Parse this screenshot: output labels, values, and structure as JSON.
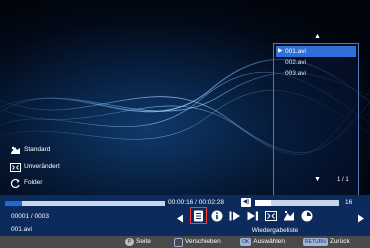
{
  "playlist": {
    "items": [
      {
        "label": "001.avi",
        "selected": true
      },
      {
        "label": "002.avi",
        "selected": false
      },
      {
        "label": "003.avi",
        "selected": false
      }
    ],
    "page": "1 / 1",
    "title": "Wiedergabeliste"
  },
  "options": [
    {
      "icon": "picture-mode-icon",
      "label": "Standard"
    },
    {
      "icon": "aspect-ratio-icon",
      "label": "Unverändert"
    },
    {
      "icon": "repeat-icon",
      "label": "Folder"
    }
  ],
  "playback": {
    "time": "00:00:16 / 00:02:28",
    "progress": 0.108,
    "volume": 16,
    "volume_level": 0.19,
    "counter": "00001 / 0003",
    "filename": "001.avi"
  },
  "controls": [
    "prev-arrow-icon",
    "playlist-icon",
    "info-icon",
    "step-forward-icon",
    "skip-next-icon",
    "fullscreen-icon",
    "aspect-icon",
    "settings-icon",
    "next-arrow-icon"
  ],
  "help": {
    "page_key": "P",
    "page_label": "Seite",
    "move_label": "Verschieben",
    "ok_key": "OK",
    "select_label": "Auswählen",
    "return_key": "RETURN",
    "back_label": "Zurück"
  },
  "colors": {
    "bar": "#0c2a5c",
    "progress_fill": "#1c6ad8",
    "selected_item": "#2f6fd8",
    "focus_outline": "#ff3b30"
  }
}
